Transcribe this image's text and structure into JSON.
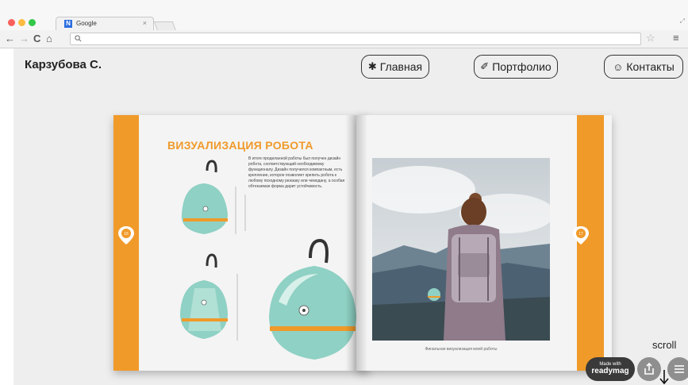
{
  "browser": {
    "tab_title": "Google",
    "tab_close": "×",
    "favicon_letter": "N",
    "nav_back": "←",
    "nav_forward": "→",
    "nav_reload": "C",
    "nav_home": "⌂",
    "search_glyph": "🔍",
    "star": "☆",
    "menu": "≡",
    "traffic_light_colors": [
      "#fc605c",
      "#fdbc40",
      "#34c84a"
    ]
  },
  "site": {
    "brand": "Карзубова С.",
    "nav": [
      {
        "icon": "✱",
        "icon_name": "asterisk-icon",
        "label": "Главная"
      },
      {
        "icon": "✐",
        "icon_name": "pencil-icon",
        "label": "Портфолио"
      },
      {
        "icon": "☺",
        "icon_name": "smiley-icon",
        "label": "Контакты"
      }
    ]
  },
  "book": {
    "left_page_number": "16",
    "right_page_number": "17",
    "heading": "ВИЗУАЛИЗАЦИЯ РОБОТА",
    "paragraph": "В итоге проделанной работы был получен дизайн робота, соответствующий необходимому функционалу. Дизайн получился компактным, есть крепление, которое позволяет крепить робота к любому походному рюкзаку или чемодану, а особая обтекаемая форма дарит устойчивость.",
    "photo_caption": "Финальная визуализация моей работы",
    "accent_color": "#f09a2a",
    "robot_color": "#8fd1c4"
  },
  "overlay": {
    "scroll_label": "scroll",
    "made_with_small": "Made with",
    "made_with_brand": "readymag",
    "share_icon": "share-icon",
    "menu_icon": "hamburger-icon"
  }
}
